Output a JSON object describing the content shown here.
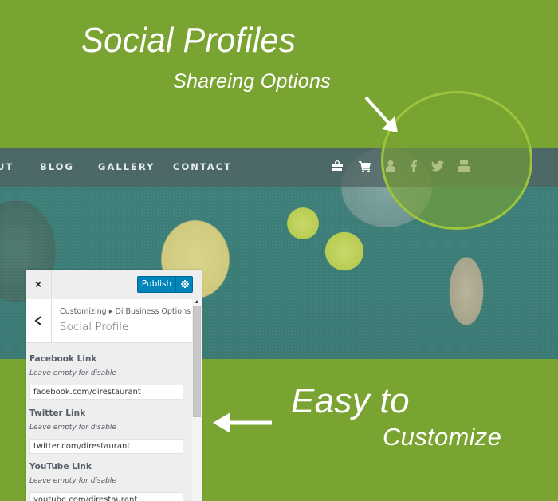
{
  "headlines": {
    "social_profiles": "Social Profiles",
    "sharing_options": "Shareing Options",
    "easy_to": "Easy to",
    "customize": "Customize"
  },
  "site_nav": {
    "links": [
      "UT",
      "BLOG",
      "GALLERY",
      "CONTACT"
    ],
    "icons": [
      "shopping-bag-icon",
      "cart-icon",
      "user-icon",
      "facebook-icon",
      "twitter-icon",
      "youtube-icon"
    ]
  },
  "customizer": {
    "close_label": "×",
    "publish_label": "Publish",
    "settings_icon": "gear-icon",
    "back_label": "‹",
    "breadcrumb": "Customizing ▸ Di Business Options",
    "section_title": "Social Profile",
    "fields": [
      {
        "label": "Facebook Link",
        "description": "Leave empty for disable",
        "value": "facebook.com/direstaurant"
      },
      {
        "label": "Twitter Link",
        "description": "Leave empty for disable",
        "value": "twitter.com/direstaurant"
      },
      {
        "label": "YouTube Link",
        "description": "Leave empty for disable",
        "value": "youtube.com/direstaurant"
      }
    ]
  },
  "colors": {
    "background_green": "#79a431",
    "highlight_ring": "#9dc43a",
    "publish_blue": "#0085ba"
  }
}
